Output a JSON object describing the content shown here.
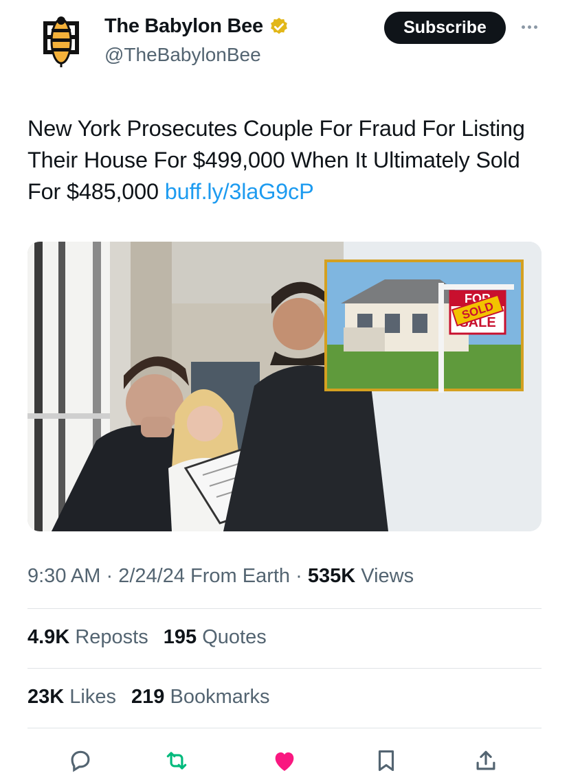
{
  "account": {
    "display_name": "The Babylon Bee",
    "handle": "@TheBabylonBee",
    "verified": true,
    "logo_icon": "bee-logo-icon"
  },
  "header": {
    "subscribe_label": "Subscribe",
    "more_icon": "more-options-icon"
  },
  "tweet": {
    "text": "New York Prosecutes Couple For Fraud For Listing Their House For $499,000 When It Ultimately Sold For $485,000",
    "link": "buff.ly/3laG9cP",
    "media": {
      "sign_text_top": "FOR",
      "sign_text_bottom": "SALE",
      "sold_tag": "SOLD"
    }
  },
  "meta": {
    "time": "9:30 AM",
    "separator": "·",
    "date": "2/24/24",
    "source": "From Earth",
    "views_count": "535K",
    "views_label": "Views"
  },
  "stats": {
    "reposts_count": "4.9K",
    "reposts_label": "Reposts",
    "quotes_count": "195",
    "quotes_label": "Quotes",
    "likes_count": "23K",
    "likes_label": "Likes",
    "bookmarks_count": "219",
    "bookmarks_label": "Bookmarks"
  },
  "actions": [
    {
      "icon": "reply-icon"
    },
    {
      "icon": "repost-icon"
    },
    {
      "icon": "like-icon"
    },
    {
      "icon": "bookmark-icon"
    },
    {
      "icon": "share-icon"
    }
  ],
  "colors": {
    "text": "#0f1419",
    "secondary": "#536471",
    "link": "#1d9bf0",
    "repost_active": "#00ba7c",
    "like_active": "#f91880",
    "verified_gold": "#e2b719",
    "subscribe_bg": "#0f1419"
  }
}
